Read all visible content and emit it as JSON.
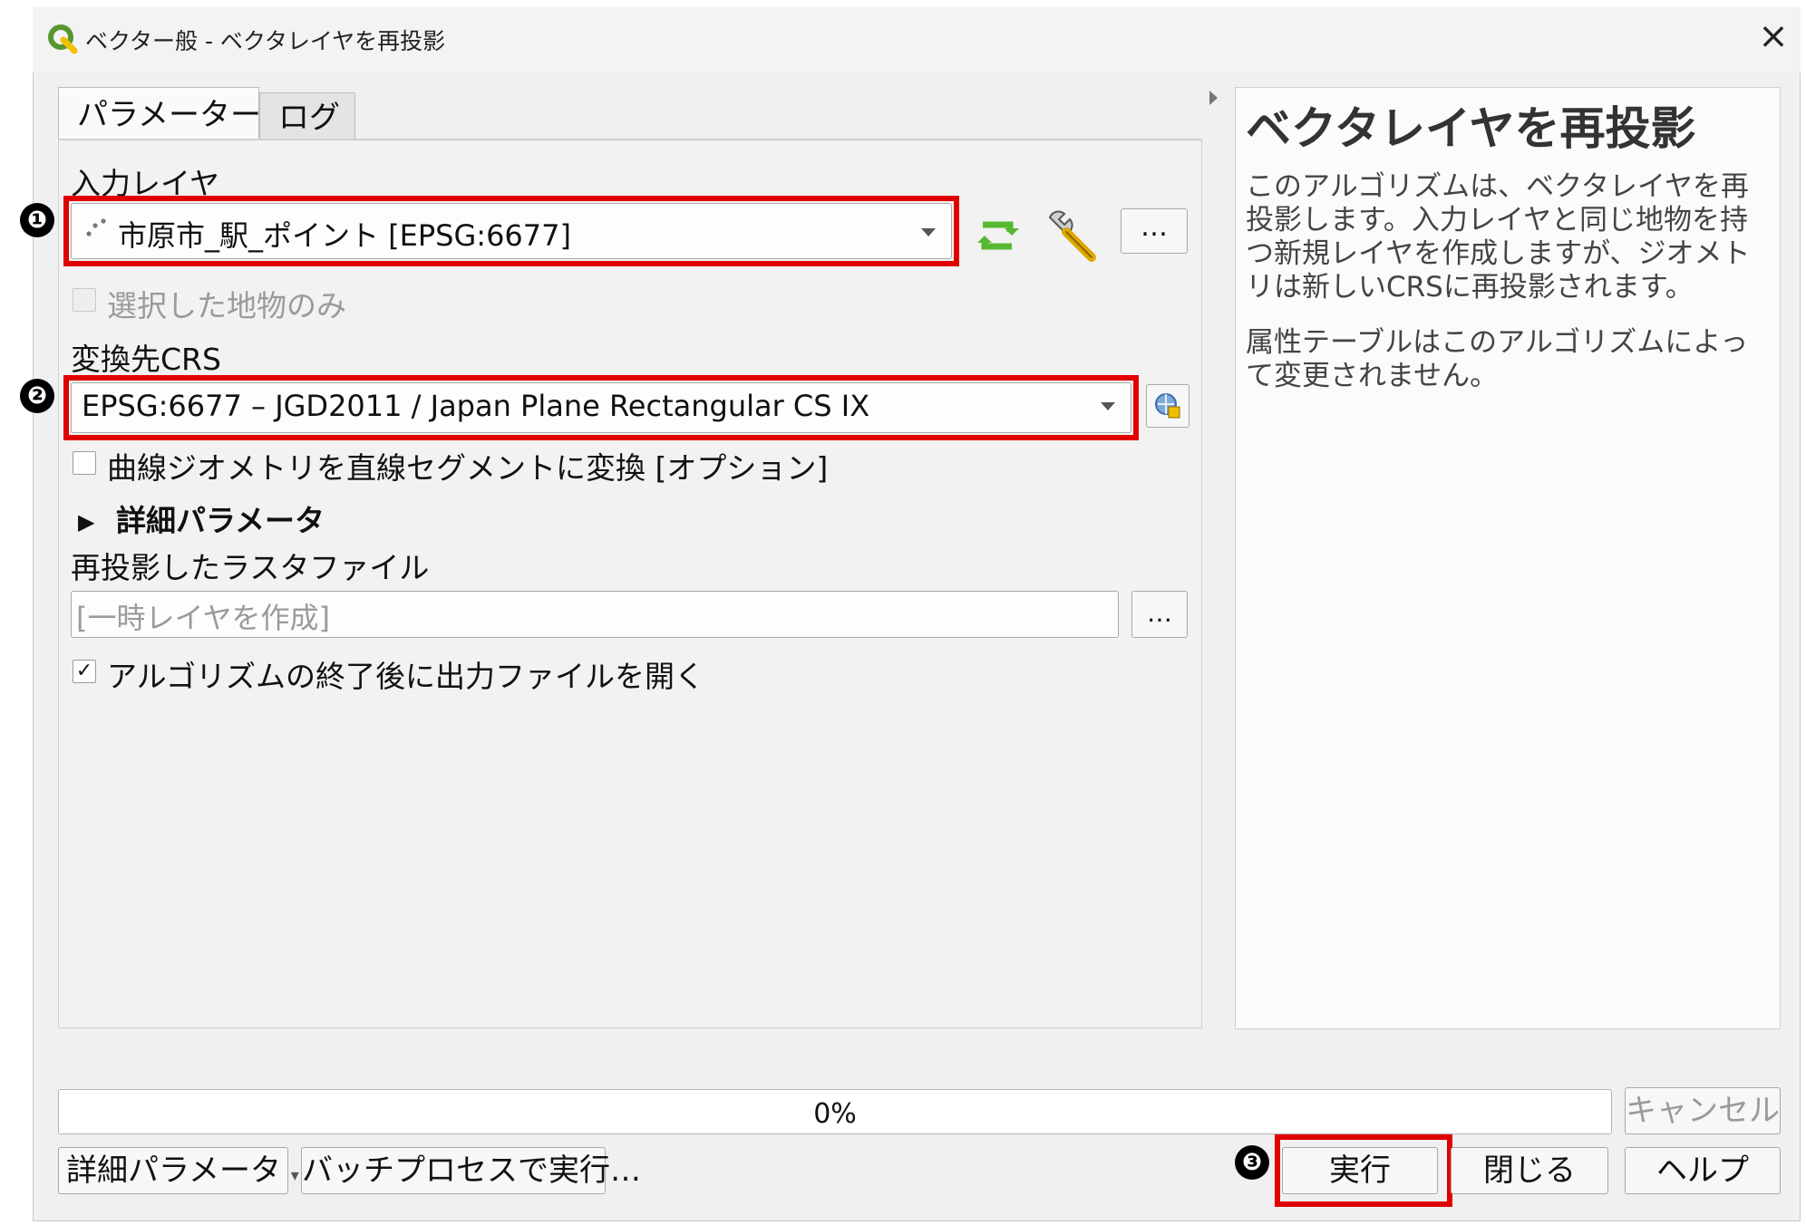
{
  "window": {
    "title": "ベクター般 - ベクタレイヤを再投影",
    "close_glyph": "×"
  },
  "tabs": [
    {
      "label": "パラメーター",
      "active": true
    },
    {
      "label": "ログ",
      "active": false
    }
  ],
  "params": {
    "input_layer_label": "入力レイヤ",
    "input_layer_value": "市原市_駅_ポイント [EPSG:6677]",
    "input_layer_more": "…",
    "selected_only_label": "選択した地物のみ",
    "selected_only_checked": false,
    "target_crs_label": "変換先CRS",
    "target_crs_value": "EPSG:6677 – JGD2011 / Japan Plane Rectangular CS IX",
    "curves_label": "曲線ジオメトリを直線セグメントに変換 [オプション]",
    "curves_checked": false,
    "advanced_label": "詳細パラメータ",
    "output_label": "再投影したラスタファイル",
    "output_placeholder": "[一時レイヤを作成]",
    "output_more": "…",
    "open_output_label": "アルゴリズムの終了後に出力ファイルを開く",
    "open_output_checked": true,
    "check_glyph": "✓",
    "collapse_glyph": "▶"
  },
  "annotations": [
    "❶",
    "❷",
    "❸"
  ],
  "help": {
    "title": "ベクタレイヤを再投影",
    "paragraph1": "このアルゴリズムは、ベクタレイヤを再投影します。入力レイヤと同じ地物を持つ新規レイヤを作成しますが、ジオメトリは新しいCRSに再投影されます。",
    "paragraph2": "属性テーブルはこのアルゴリズムによって変更されません。"
  },
  "progress": {
    "value": 0,
    "text": "0%"
  },
  "buttons": {
    "cancel": "キャンセル",
    "advanced": "詳細パラメータ",
    "batch": "バッチプロセスで実行…",
    "run": "実行",
    "close": "閉じる",
    "help": "ヘルプ"
  },
  "icons": [
    "qgis-logo-icon",
    "points-layer-icon",
    "iterate-icon",
    "wrench-icon",
    "crs-selector-icon",
    "dropdown-arrow-icon",
    "expand-arrow-icon",
    "close-icon"
  ],
  "colors": {
    "highlight": "#e00000",
    "qgis_green": "#589632",
    "qgis_yellow": "#f0c000"
  }
}
